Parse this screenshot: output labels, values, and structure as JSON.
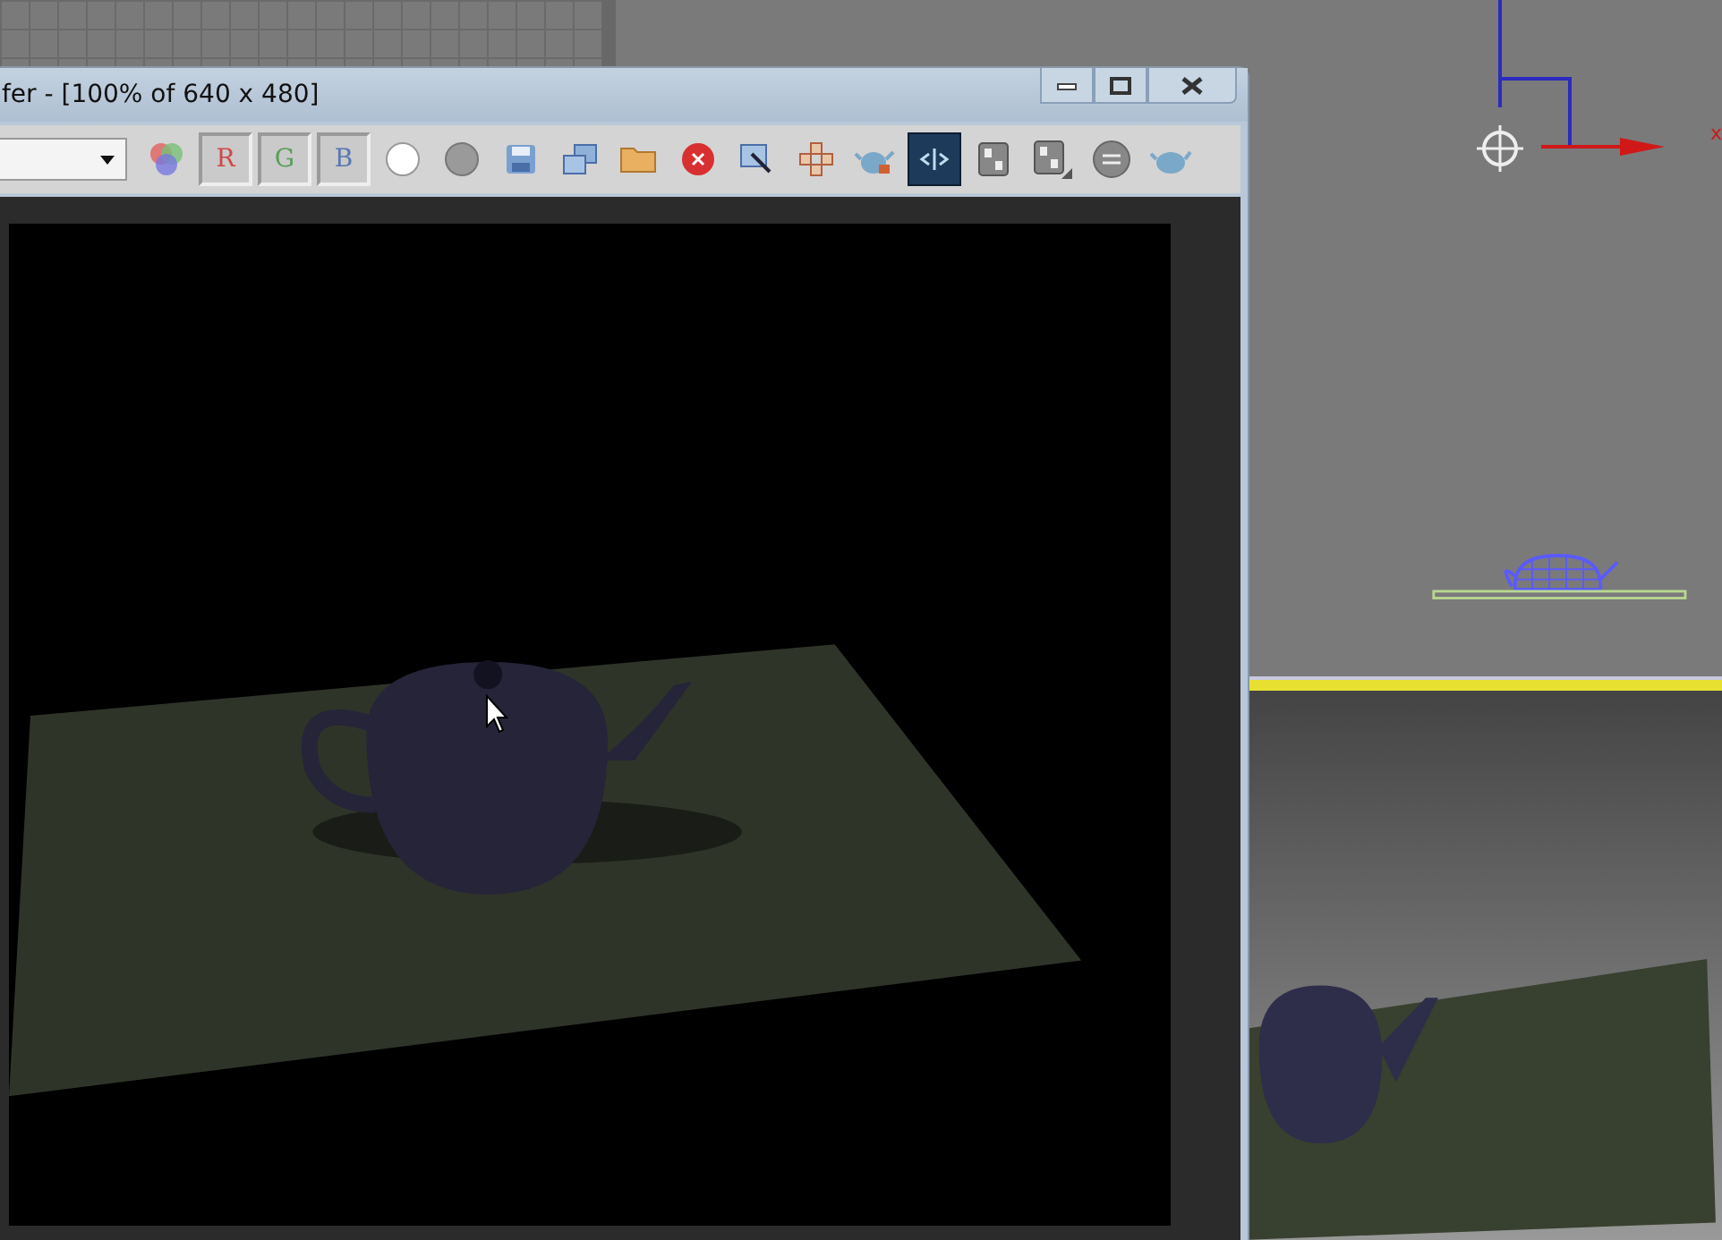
{
  "window": {
    "title": "fer - [100% of 640 x 480]"
  },
  "channels": [
    {
      "label": "R",
      "on": true
    },
    {
      "label": "G",
      "on": true
    },
    {
      "label": "B",
      "on": true
    }
  ],
  "view_toggle": {
    "on": true
  },
  "viewport": {
    "axis_label": "x"
  }
}
